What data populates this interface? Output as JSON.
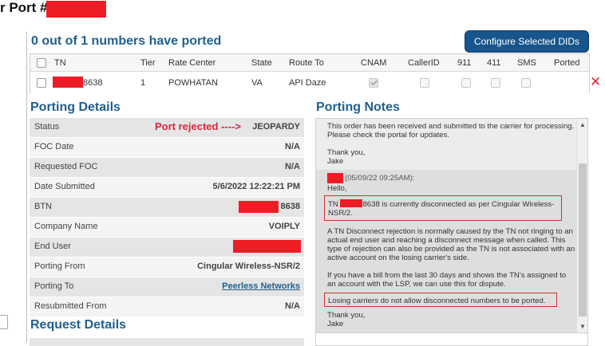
{
  "page": {
    "heading": "r Port #"
  },
  "summary": {
    "text": "0 out of 1 numbers have ported",
    "configure_button": "Configure Selected DIDs"
  },
  "did_table": {
    "headers": [
      "TN",
      "Tier",
      "Rate Center",
      "State",
      "Route To",
      "CNAM",
      "CallerID",
      "911",
      "411",
      "SMS",
      "Ported"
    ],
    "row": {
      "tn_suffix": "8638",
      "tier": "1",
      "rate_center": "POWHATAN",
      "state": "VA",
      "route_to": "API Daze",
      "cnam_checked": true,
      "ported_icon": "close-x-icon",
      "ported_symbol": "✕"
    }
  },
  "porting_details": {
    "title": "Porting Details",
    "rejected_note": "Port rejected ---->",
    "rows": [
      {
        "label": "Status",
        "value": "JEOPARDY"
      },
      {
        "label": "FOC Date",
        "value": "N/A"
      },
      {
        "label": "Requested FOC",
        "value": "N/A"
      },
      {
        "label": "Date Submitted",
        "value": "5/6/2022 12:22:21 PM"
      },
      {
        "label": "BTN",
        "value": "8638"
      },
      {
        "label": "Company Name",
        "value": "VOIPLY"
      },
      {
        "label": "End User",
        "value": ""
      },
      {
        "label": "Porting From",
        "value": "Cingular Wireless-NSR/2"
      },
      {
        "label": "Porting To",
        "value": "Peerless Networks"
      },
      {
        "label": "Resubmitted From",
        "value": "N/A"
      }
    ]
  },
  "porting_notes": {
    "title": "Porting Notes",
    "note1": {
      "body": "This order has been received and submitted to the carrier for processing. Please check the portal for updates.",
      "thanks": "Thank you,",
      "signature": "Jake"
    },
    "note2": {
      "timestamp": "(05/09/22 09:25AM):",
      "greeting": "Hello,",
      "tn_prefix": "TN",
      "tn_text": "8638 is currently disconnected as per Cingular Wireless-NSR/2.",
      "para1": "A TN Disconnect rejection is normally caused by the TN not ringing to an actual end user and reaching a disconnect message when called. This type of rejection can also be provided as the TN is not associated with an active account on the losing carrier's side.",
      "para2": "If you have a bill from the last 30 days and shows the TN's assigned to an account with the LSP, we can use this for dispute.",
      "para3": "Losing carriers do not allow disconnected numbers to be ported.",
      "thanks": "Thank you,",
      "signature": "Jake"
    }
  },
  "request_details": {
    "title": "Request Details"
  },
  "colors": {
    "accent": "#1f5f8f",
    "button": "#17558c",
    "reject": "#d9283b",
    "redaction": "#ee1c25"
  }
}
